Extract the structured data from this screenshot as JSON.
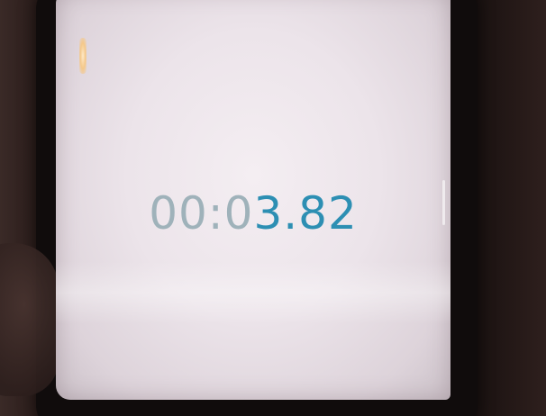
{
  "stopwatch": {
    "elapsed_dim": "00:0",
    "elapsed_active": "3.82",
    "colors": {
      "dim_digits": "#9fb2ba",
      "active_digits": "#2d8fb3",
      "screen_background": "#f0e9ee"
    }
  }
}
